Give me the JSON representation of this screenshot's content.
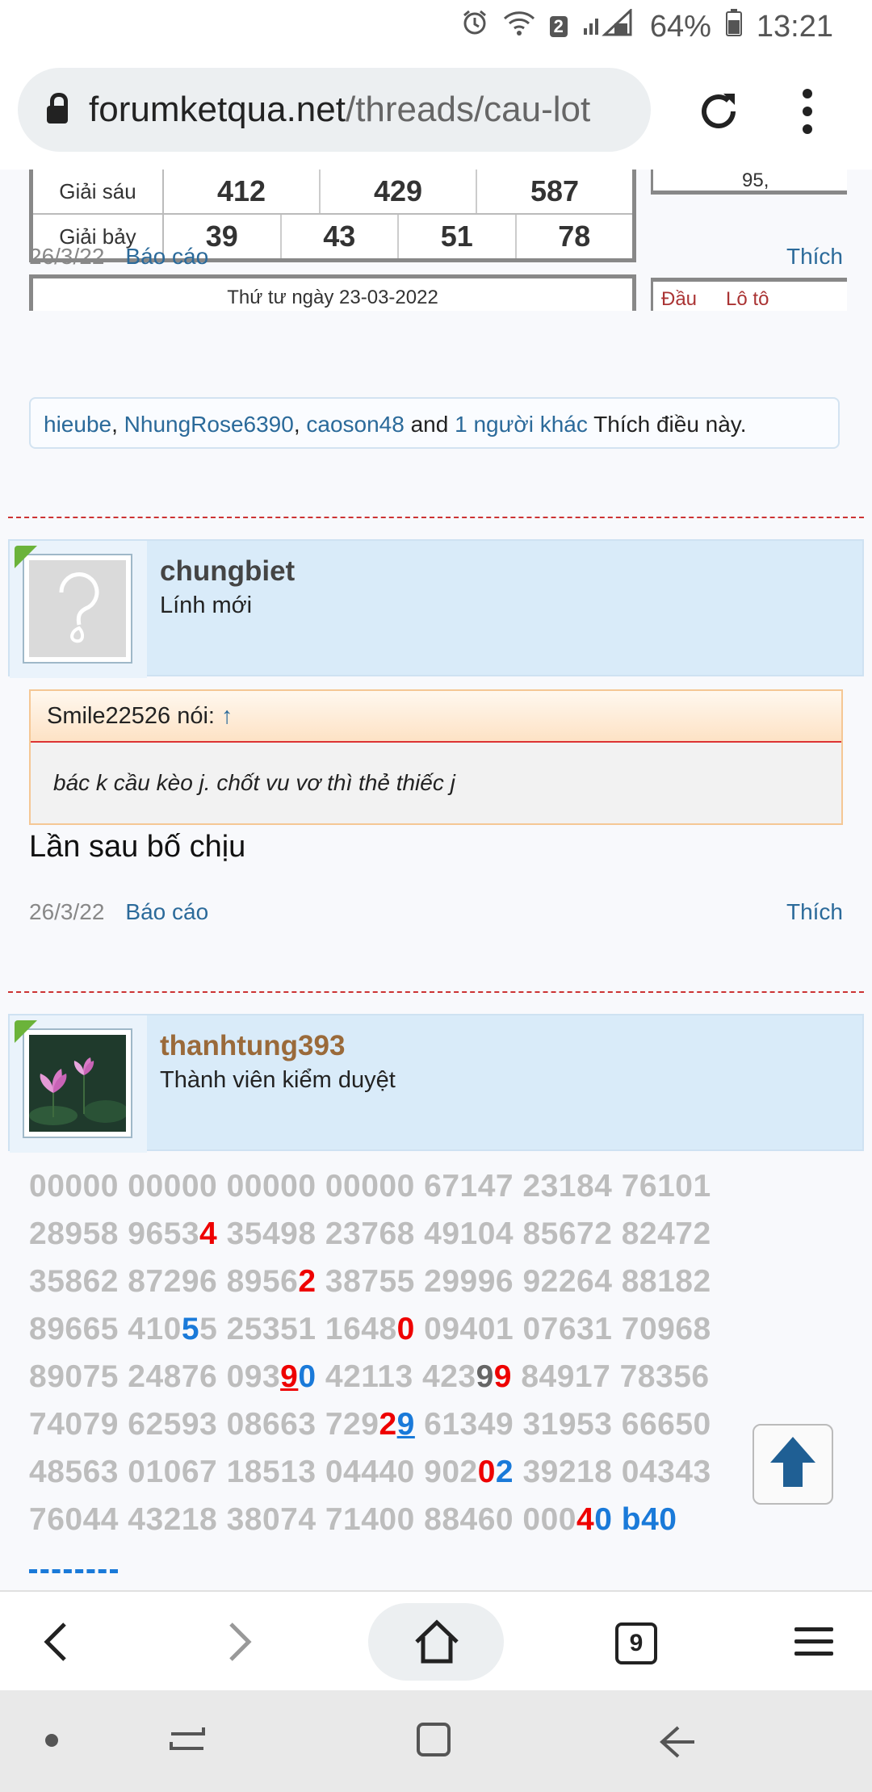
{
  "status_bar": {
    "network_badge": "2",
    "battery": "64%",
    "time": "13:21",
    "icons": [
      "alarm-icon",
      "wifi-icon",
      "signal-icon",
      "battery-icon"
    ]
  },
  "browser": {
    "url_domain": "forumketqua.net",
    "url_path": "/threads/cau-lot",
    "tabs_count": "9"
  },
  "lottery": {
    "rows": [
      {
        "label": "Giải sáu",
        "values": [
          "412",
          "429",
          "587"
        ]
      },
      {
        "label": "Giải bảy",
        "values": [
          "39",
          "43",
          "51",
          "78"
        ]
      }
    ],
    "next_date": "Thứ tư ngày 23-03-2022",
    "side_fragment": "95,",
    "side_head_1": "Đầu",
    "side_head_2": "Lô tô"
  },
  "post1": {
    "date": "26/3/22",
    "report": "Báo cáo",
    "like": "Thích",
    "likers": [
      "hieube",
      "NhungRose6390",
      "caoson48"
    ],
    "likes_and": "and",
    "likes_others": "1 người khác",
    "likes_suffix": "Thích điều này."
  },
  "post2": {
    "username": "chungbiet",
    "user_title": "Lính mới",
    "quote_author": "Smile22526 nói:",
    "quote_arrow": "↑",
    "quote_text": "bác k cầu kèo j. chốt vu vơ thì thẻ thiếc j",
    "body": "Lần sau bố chịu",
    "date": "26/3/22",
    "report": "Báo cáo",
    "like": "Thích"
  },
  "post3": {
    "username": "thanhtung393",
    "user_title": "Thành viên kiểm duyệt",
    "number_lines": [
      "00000 00000 00000 00000 67147 23184 76101",
      "28958 96534 35498 23768 49104 85672 82472",
      "35862 87296 89562 38755 29996 92264 88182",
      "89665 41055 25351 16480 09401 07631 70968",
      "89075 24876 09390 42113 42399 84917 78356",
      "74079 62593 08663 72929 61349 31953 66650",
      "48563 01067 18513 04440 90202 39218 04343",
      "76044 43218 38074 71400 88460 00040 b40"
    ]
  },
  "colors": {
    "link": "#2b6a9a",
    "user_gold": "#9a6a3a",
    "highlight_red": "#e00000",
    "highlight_blue": "#1a7ad9",
    "user_header_bg": "#d9ebf9"
  }
}
